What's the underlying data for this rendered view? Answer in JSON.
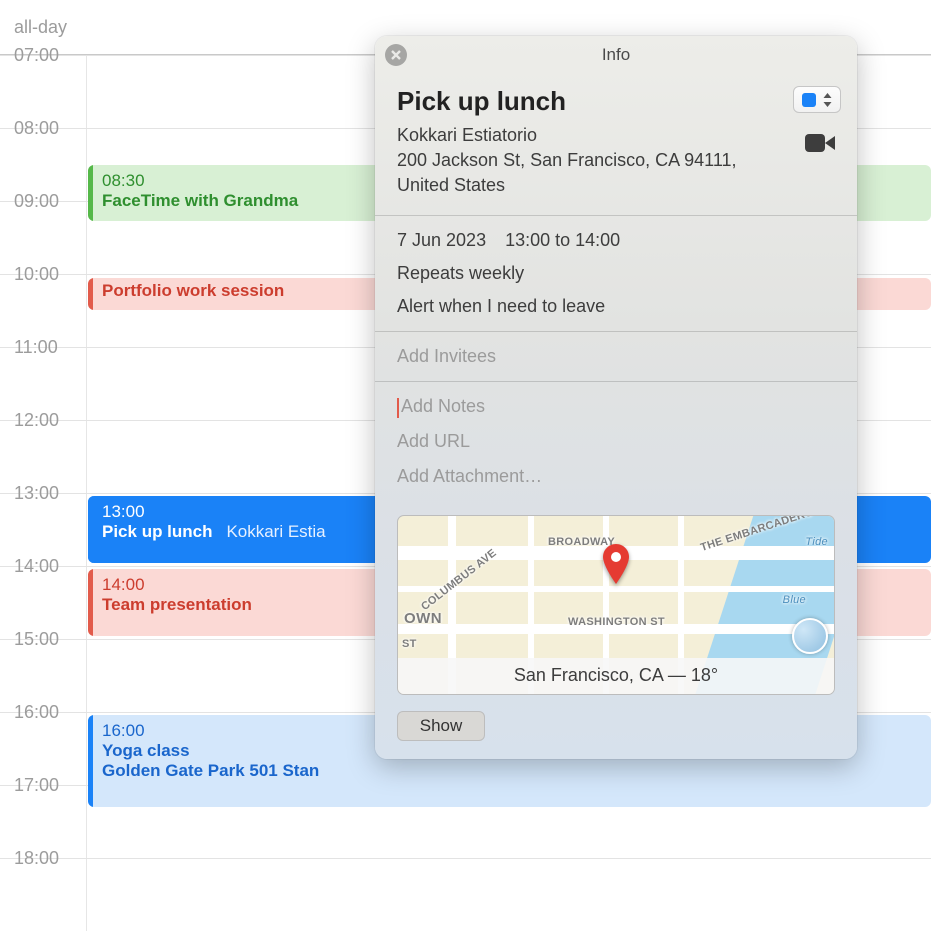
{
  "allday_label": "all-day",
  "hours": [
    "07:00",
    "08:00",
    "09:00",
    "10:00",
    "11:00",
    "12:00",
    "13:00",
    "14:00",
    "15:00",
    "16:00",
    "17:00",
    "18:00"
  ],
  "events": {
    "facetime": {
      "time": "08:30",
      "title": "FaceTime with Grandma"
    },
    "portfolio": {
      "time": "",
      "title": "Portfolio work session"
    },
    "lunch": {
      "time": "13:00",
      "title": "Pick up lunch",
      "loc": "Kokkari Estia"
    },
    "team": {
      "time": "14:00",
      "title": "Team presentation"
    },
    "yoga": {
      "time": "16:00",
      "title": "Yoga class",
      "loc": "Golden Gate Park 501 Stan"
    }
  },
  "popover": {
    "header": "Info",
    "title": "Pick up lunch",
    "location": "Kokkari Estiatorio\n200 Jackson St, San Francisco, CA 94111, United States",
    "date": "7 Jun 2023",
    "time": "13:00 to 14:00",
    "repeat": "Repeats weekly",
    "alert": "Alert when I need to leave",
    "invitees_placeholder": "Add Invitees",
    "notes_placeholder": "Add Notes",
    "url_placeholder": "Add URL",
    "attachment_placeholder": "Add Attachment…",
    "map_caption": "San Francisco, CA — 18°",
    "show_button": "Show",
    "map_labels": {
      "broadway": "BROADWAY",
      "columbus": "COLUMBUS AVE",
      "embarcadero": "THE EMBARCADERO",
      "washington": "WASHINGTON ST",
      "own": "OWN",
      "st": "ST",
      "tide": "Tide",
      "blue": "Blue"
    },
    "calendar_color": "#1a82f7"
  }
}
